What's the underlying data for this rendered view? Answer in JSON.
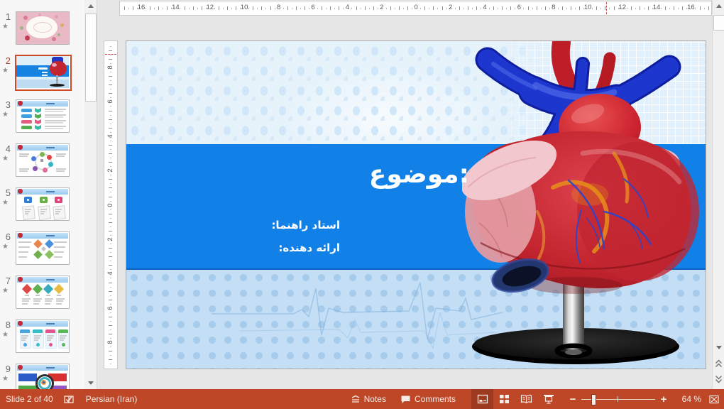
{
  "slide_panel": {
    "selected_number": "2",
    "items": [
      {
        "number": "1",
        "kind": "floral",
        "starred": true
      },
      {
        "number": "2",
        "kind": "heart-title",
        "starred": true
      },
      {
        "number": "3",
        "kind": "chevron-list",
        "starred": true
      },
      {
        "number": "4",
        "kind": "circle-diagram",
        "starred": true
      },
      {
        "number": "5",
        "kind": "numbered-tags",
        "starred": true
      },
      {
        "number": "6",
        "kind": "diamond-spread",
        "starred": true
      },
      {
        "number": "7",
        "kind": "diamond-flow",
        "starred": true
      },
      {
        "number": "8",
        "kind": "four-cards",
        "starred": true
      },
      {
        "number": "9",
        "kind": "target-grid",
        "starred": true
      }
    ]
  },
  "rulers": {
    "horizontal_labels": [
      "16",
      "14",
      "12",
      "10",
      "8",
      "6",
      "4",
      "2",
      "0",
      "2",
      "4",
      "6",
      "8",
      "10",
      "12",
      "14",
      "16"
    ],
    "vertical_labels": [
      "8",
      "6",
      "4",
      "2",
      "0",
      "2",
      "4",
      "6",
      "8"
    ]
  },
  "slide": {
    "title": "موضوع:",
    "supervisor_label": "استاد راهنما:",
    "presenter_label": "ارائه دهنده:",
    "band_color": "#1181E8"
  },
  "status_bar": {
    "slide_indicator": "Slide 2 of 40",
    "language": "Persian (Iran)",
    "notes_label": "Notes",
    "comments_label": "Comments",
    "zoom_value": "64 %"
  },
  "colors": {
    "status_bar_bg": "#BE4728",
    "selection_orange": "#CE4B26",
    "ruler_marker": "#C0504D"
  }
}
